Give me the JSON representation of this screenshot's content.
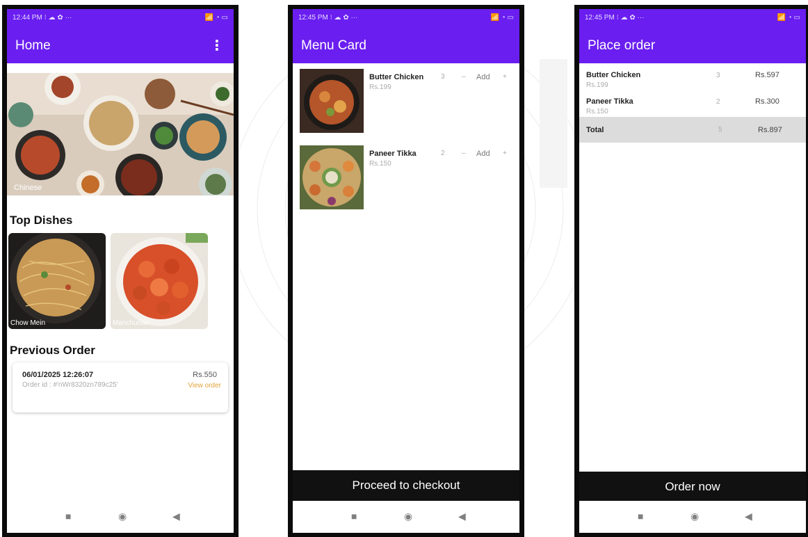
{
  "colors": {
    "primary": "#6a1ef0",
    "bottom_bar": "#111111",
    "accent_link": "#e0a33a"
  },
  "home": {
    "status": {
      "time": "12:44 PM ⁝ ☁ ✿ ···",
      "icons": "📶 ◔ ▭"
    },
    "title": "Home",
    "menu_icon": "more-vert-icon",
    "hero_caption": "Chinese",
    "top_dishes_heading": "Top Dishes",
    "dishes": [
      {
        "label": "Chow Mein"
      },
      {
        "label": "Manchurian"
      }
    ],
    "previous_order_heading": "Previous Order",
    "order": {
      "datetime": "06/01/2025 12:26:07",
      "order_id": "Order id : #'nWr8320zn789c25'",
      "amount": "Rs.550",
      "view_label": "View order"
    }
  },
  "menu": {
    "status": {
      "time": "12:45 PM ⁝ ☁ ✿ ···",
      "icons": "📶 ◔ ▭"
    },
    "title": "Menu Card",
    "items": [
      {
        "name": "Butter Chicken",
        "price": "Rs.199",
        "qty": "3",
        "minus": "–",
        "add": "Add",
        "plus": "+"
      },
      {
        "name": "Paneer Tikka",
        "price": "Rs.150",
        "qty": "2",
        "minus": "–",
        "add": "Add",
        "plus": "+"
      }
    ],
    "checkout_label": "Proceed to checkout"
  },
  "place_order": {
    "status": {
      "time": "12:45 PM ⁝ ☁ ✿ ···",
      "icons": "📶 ◔ ▭"
    },
    "title": "Place order",
    "rows": [
      {
        "name": "Butter Chicken",
        "unit_price": "Rs.199",
        "qty": "3",
        "amount": "Rs.597"
      },
      {
        "name": "Paneer Tikka",
        "unit_price": "Rs.150",
        "qty": "2",
        "amount": "Rs.300"
      }
    ],
    "total": {
      "label": "Total",
      "qty": "5",
      "amount": "Rs.897"
    },
    "order_now_label": "Order now"
  },
  "navbar": {
    "recents": "■",
    "home": "◉",
    "back": "◀"
  }
}
